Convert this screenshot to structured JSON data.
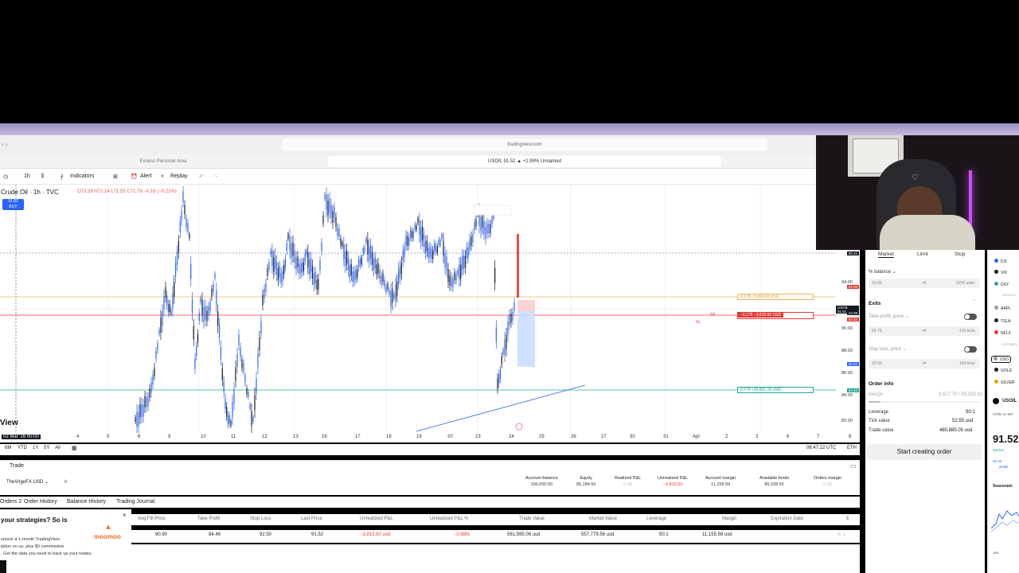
{
  "browser": {
    "url": "tradingview.com",
    "tab1": "Exness Personal Area",
    "tab2": "USOIL 91.52 ▲ +2.99% Unnamed"
  },
  "toolbar": {
    "interval": "1h",
    "indicators": "Indicators",
    "alert": "Alert",
    "replay": "Replay"
  },
  "chart": {
    "symbol": "Crude Oil · 1h · TVC",
    "ohlc": "O72.39 H72.14 L71.55 C71.78 −0.16 (−0.21%)",
    "buy_price": "91.82",
    "buy_label": "BUY",
    "price_ticks": [
      "94.00",
      "90.00",
      "88.00",
      "86.00",
      "84.00",
      "82.00"
    ],
    "price_badges": [
      {
        "text": "96.34",
        "color": "#131722"
      },
      {
        "text": "92.59",
        "color": "#e53935"
      },
      {
        "text": "USOIL 91.81",
        "color": "#131722"
      },
      {
        "text": "12:38",
        "color": "#131722"
      },
      {
        "text": "90.50",
        "color": "#e53935"
      },
      {
        "text": "86.62",
        "color": "#2962ff"
      },
      {
        "text": "84.46",
        "color": "#26a69a"
      }
    ],
    "tp_line": "6,178  −9,869.94 USD",
    "sl_line": "−6,178   −3,815.60 USD",
    "tp_sl_tags": [
      "TP",
      "SL"
    ],
    "target_line": "6,178  +39,801.18 USD",
    "time_labels": [
      "02 Mar '26  00:00",
      "4",
      "5",
      "6",
      "9",
      "10",
      "11",
      "12",
      "13",
      "16",
      "17",
      "18",
      "19",
      "20",
      "23",
      "24",
      "25",
      "26",
      "27",
      "30",
      "31",
      "Apr",
      "2",
      "3",
      "6",
      "7",
      "8"
    ],
    "ranges": [
      "6M",
      "YTD",
      "1Y",
      "5Y",
      "All"
    ],
    "clock": "06:47:22 UTC",
    "session": "ETH",
    "watermark": "View"
  },
  "trade": {
    "tab_label": "Trade",
    "account_name": "TheVirgoFX USD",
    "account_cols": [
      {
        "label": "Account balance",
        "value": "100,000.00"
      },
      {
        "label": "Equity",
        "value": "96,184.50"
      },
      {
        "label": "Realized P&L",
        "value": "0.00"
      },
      {
        "label": "Unrealized P&L",
        "value": "−3,815.50"
      },
      {
        "label": "Account margin",
        "value": "11,155.59"
      },
      {
        "label": "Available funds",
        "value": "85,028.91"
      },
      {
        "label": "Orders margin",
        "value": "0.00"
      }
    ],
    "subtabs": [
      "Orders 2",
      "Order History",
      "Balance History",
      "Trading Journal"
    ],
    "headers": [
      "Avg Fill Price",
      "Take Profit",
      "Stop Loss",
      "Last Price",
      "Unrealized P&L",
      "Unrealized P&L %",
      "Trade Value",
      "Market Value",
      "Leverage",
      "Margin",
      "Expiration Date"
    ],
    "row": [
      "90.90",
      "84.46",
      "92.50",
      "91.52",
      "−3,815.50 usd",
      "−0.68%",
      "561,595.06 usd",
      "557,779.56 usd",
      "50:1",
      "11,155.59 usd",
      ""
    ]
  },
  "promo": {
    "title": "your strategies? So is",
    "line1": "unlock a 1-month TradingView",
    "line2": "iption on us, plus $0 commission",
    "line3": ". Get the data you need to back up your trades.",
    "brand": "moomoo"
  },
  "order_panel": {
    "tabs": [
      "Market",
      "Limit",
      "Stop"
    ],
    "balance_label": "% balance",
    "qty": "10.00",
    "units": "5255 units",
    "exits": "Exits",
    "tp_label": "Take profit, price",
    "tp_value": "86.76",
    "tp_ticks": "410 ticks",
    "sl_label": "Stop loss, price",
    "sl_value": "92.50",
    "sl_ticks": "164 ticks",
    "order_info": "Order info",
    "margin_label": "Margin",
    "margin_value": "9,617.70 / 85,028.91",
    "leverage_label": "Leverage",
    "leverage_value": "50:1",
    "tick_label": "Tick value",
    "tick_value": "52.55 usd",
    "trade_value_label": "Trade value",
    "trade_value": "480,885.05 usd",
    "button": "Start creating order"
  },
  "watchlist": {
    "items": [
      "DJI",
      "VIX",
      "DXY",
      "STOCKS",
      "AAPL",
      "TSLA",
      "NFLX",
      "FUTURES",
      "USO",
      "GOLD",
      "SILVER"
    ],
    "symbol": "USOIL",
    "desc": "CFDs on WT",
    "price": "91.52",
    "status": "Market",
    "note1": "23 mi",
    "note2": "yields",
    "seasonals": "Seasonals",
    "month": "Jan"
  }
}
